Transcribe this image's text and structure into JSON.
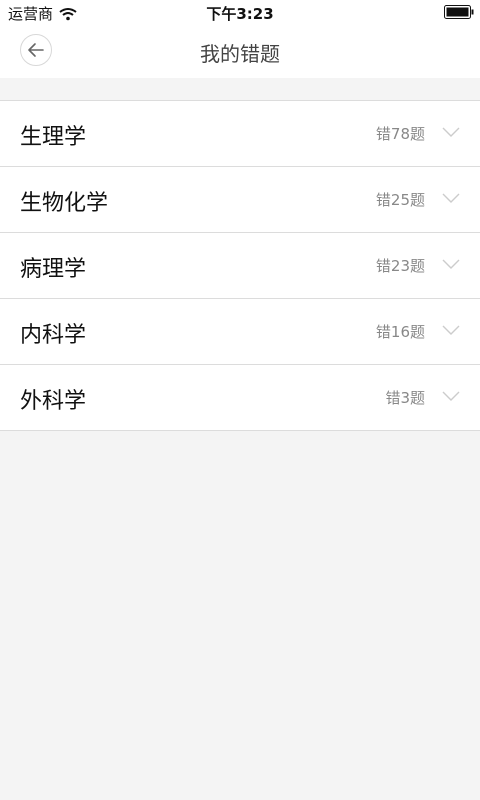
{
  "status_bar": {
    "carrier": "运营商",
    "time": "下午3:23"
  },
  "nav": {
    "title": "我的错题",
    "back_icon": "arrow-left-icon"
  },
  "subjects": [
    {
      "name": "生理学",
      "count": "错78题"
    },
    {
      "name": "生物化学",
      "count": "错25题"
    },
    {
      "name": "病理学",
      "count": "错23题"
    },
    {
      "name": "内科学",
      "count": "错16题"
    },
    {
      "name": "外科学",
      "count": "错3题"
    }
  ],
  "colors": {
    "background": "#f4f4f4",
    "surface": "#ffffff",
    "divider": "#dcdcdc",
    "muted_text": "#888888",
    "chevron": "#cccccc"
  }
}
